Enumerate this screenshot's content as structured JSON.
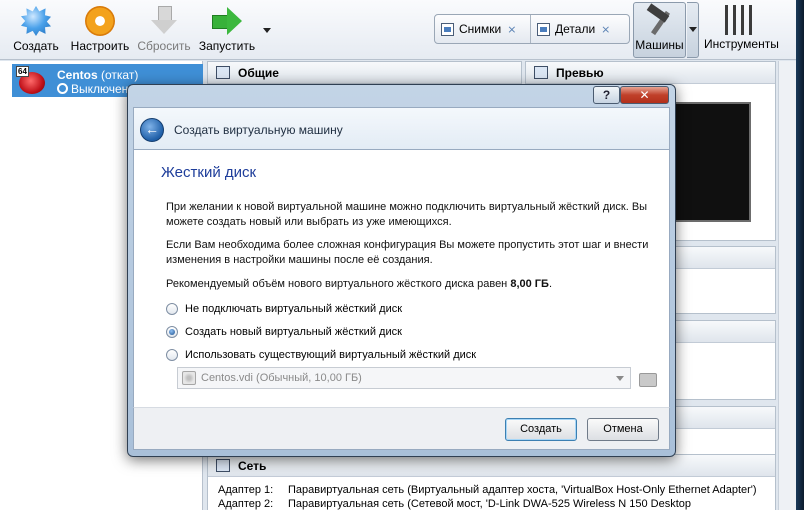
{
  "toolbar": {
    "create_label": "Создать",
    "settings_label": "Настроить",
    "reset_label": "Сбросить",
    "start_label": "Запустить",
    "snapshots_label": "Снимки",
    "details_label": "Детали",
    "machines_label": "Машины",
    "tools_label": "Инструменты",
    "pin_glyph": "⨯"
  },
  "vm_list": {
    "items": [
      {
        "os_badge": "64",
        "name": "Centos",
        "snapshot_suffix": "(откат)",
        "state": "Выключена"
      }
    ]
  },
  "panels": {
    "general_title": "Общие",
    "preview_title": "Превью",
    "network_title": "Сеть",
    "network_rows": [
      {
        "key": "Адаптер 1:",
        "value": "Паравиртуальная сеть (Виртуальный адаптер хоста, 'VirtualBox Host-Only Ethernet Adapter')"
      },
      {
        "key": "Адаптер 2:",
        "value": "Паравиртуальная сеть (Сетевой мост, 'D-Link DWA-525 Wireless N 150 Desktop"
      }
    ]
  },
  "dialog": {
    "help_label": "?",
    "close_label": "✕",
    "back_glyph": "←",
    "nav_title": "Создать виртуальную машину",
    "page_title": "Жесткий диск",
    "para1_line1": "При желании к новой виртуальной машине можно подключить виртуальный жёсткий диск. Вы",
    "para1_line2": "можете создать новый или выбрать из уже имеющихся.",
    "para2_line1": "Если Вам необходима более сложная конфигурация Вы можете пропустить этот шаг и внести",
    "para2_line2": "изменения в настройки машины после её создания.",
    "recommend_text": "Рекомендуемый объём нового виртуального жёсткого диска равен",
    "recommend_value": "8,00 ГБ",
    "recommend_end": ".",
    "options": [
      {
        "label": "Не подключать виртуальный жёсткий диск",
        "selected": false
      },
      {
        "label": "Создать новый виртуальный жёсткий диск",
        "selected": true
      },
      {
        "label": "Использовать существующий виртуальный жёсткий диск",
        "selected": false
      }
    ],
    "existing_disk_value": "Centos.vdi (Обычный, 10,00 ГБ)",
    "create_button": "Создать",
    "cancel_button": "Отмена"
  },
  "colors": {
    "selection": "#3f8fd6",
    "title_blue": "#1e3d9a"
  }
}
